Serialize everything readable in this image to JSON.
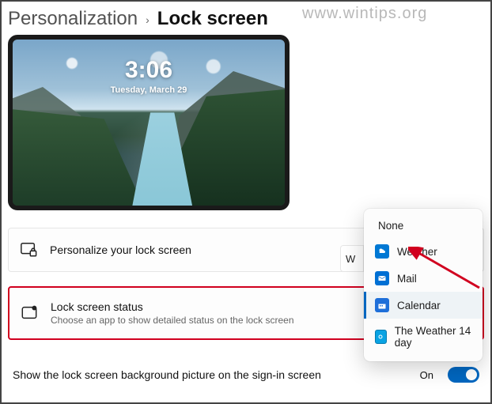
{
  "watermark": "www.wintips.org",
  "breadcrumb": {
    "parent": "Personalization",
    "separator": "›",
    "current": "Lock screen"
  },
  "preview": {
    "time": "3:06",
    "date": "Tuesday, March 29"
  },
  "settings": {
    "personalize": {
      "title": "Personalize your lock screen"
    },
    "status": {
      "title": "Lock screen status",
      "subtitle": "Choose an app to show detailed status on the lock screen"
    },
    "signin_bg": {
      "label": "Show the lock screen background picture on the sign-in screen",
      "state": "On",
      "value": true
    }
  },
  "status_dropdown": {
    "visible_partial_button_text": "W",
    "options": [
      {
        "key": "none",
        "label": "None",
        "icon": null
      },
      {
        "key": "weather",
        "label": "Weather",
        "icon": "weather-icon"
      },
      {
        "key": "mail",
        "label": "Mail",
        "icon": "mail-icon"
      },
      {
        "key": "calendar",
        "label": "Calendar",
        "icon": "calendar-icon",
        "selected": true
      },
      {
        "key": "weather14",
        "label": "The Weather 14 day",
        "icon": "weather14-icon"
      }
    ]
  },
  "colors": {
    "accent": "#0067c0",
    "highlight_border": "#d1001f"
  }
}
